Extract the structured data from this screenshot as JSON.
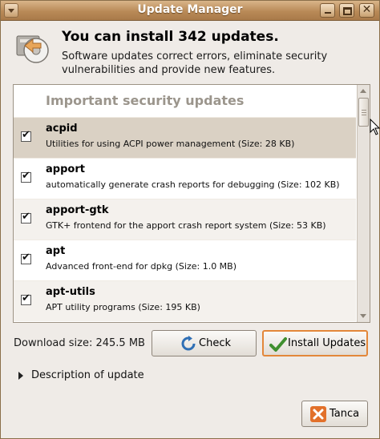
{
  "window": {
    "title": "Update Manager"
  },
  "header": {
    "title": "You can install 342 updates.",
    "description": "Software updates correct errors, eliminate security vulnerabilities and provide new features."
  },
  "updates": {
    "group_title": "Important security updates",
    "items": [
      {
        "name": "acpid",
        "description": "Utilities for using ACPI power management (Size: 28 KB)",
        "checked": true
      },
      {
        "name": "apport",
        "description": "automatically generate crash reports for debugging (Size: 102 KB)",
        "checked": true
      },
      {
        "name": "apport-gtk",
        "description": "GTK+ frontend for the apport crash report system (Size: 53 KB)",
        "checked": true
      },
      {
        "name": "apt",
        "description": "Advanced front-end for dpkg (Size: 1.0 MB)",
        "checked": true
      },
      {
        "name": "apt-utils",
        "description": "APT utility programs (Size: 195 KB)",
        "checked": true
      }
    ]
  },
  "footer": {
    "download_size": "Download size: 245.5 MB",
    "check_label": "Check",
    "install_label": "Install Updates",
    "description_toggle": "Description of update",
    "cancel_label": "Tanca"
  },
  "colors": {
    "titlebar": "#b98a57",
    "install_border": "#e3873a",
    "selected_row": "#dad1c4"
  }
}
